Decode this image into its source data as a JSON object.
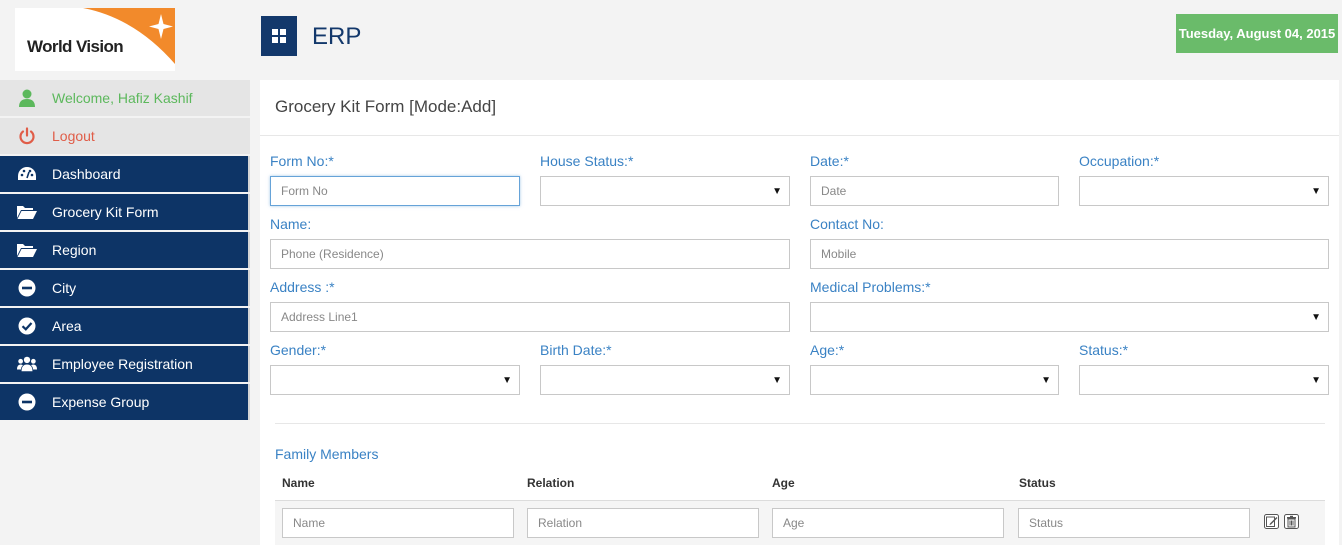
{
  "logo": {
    "text": "World Vision"
  },
  "header": {
    "title": "ERP",
    "date": "Tuesday, August 04, 2015"
  },
  "sidebar": {
    "welcome": "Welcome, Hafiz Kashif",
    "logout": "Logout",
    "items": [
      {
        "label": "Dashboard",
        "icon": "dashboard-icon"
      },
      {
        "label": "Grocery Kit Form",
        "icon": "folder-open-icon"
      },
      {
        "label": "Region",
        "icon": "folder-open-icon"
      },
      {
        "label": "City",
        "icon": "minus-circle-icon"
      },
      {
        "label": "Area",
        "icon": "check-circle-icon"
      },
      {
        "label": "Employee Registration",
        "icon": "users-icon"
      },
      {
        "label": "Expense Group",
        "icon": "minus-circle-icon"
      }
    ]
  },
  "form": {
    "title": "Grocery Kit Form [Mode:Add]",
    "form_no": {
      "label": "Form No:*",
      "placeholder": "Form No"
    },
    "house_status": {
      "label": "House Status:*",
      "value": ""
    },
    "date": {
      "label": "Date:*",
      "placeholder": "Date"
    },
    "occupation": {
      "label": "Occupation:*",
      "value": ""
    },
    "name": {
      "label": "Name:",
      "placeholder": "Phone (Residence)"
    },
    "contact_no": {
      "label": "Contact No:",
      "placeholder": "Mobile"
    },
    "address": {
      "label": "Address :*",
      "placeholder": "Address Line1"
    },
    "medical_problems": {
      "label": "Medical Problems:*",
      "value": ""
    },
    "gender": {
      "label": "Gender:*",
      "value": ""
    },
    "birth_date": {
      "label": "Birth Date:*",
      "value": ""
    },
    "age": {
      "label": "Age:*",
      "value": ""
    },
    "status": {
      "label": "Status:*",
      "value": ""
    }
  },
  "family": {
    "title": "Family Members",
    "columns": [
      "Name",
      "Relation",
      "Age",
      "Status"
    ],
    "row_placeholders": [
      "Name",
      "Relation",
      "Age",
      "Status"
    ]
  },
  "colors": {
    "navy": "#0d3466",
    "accent_blue": "#3a82c4",
    "green": "#6abb6a",
    "logout_red": "#e05d48",
    "brand_orange": "#f28a2b"
  }
}
